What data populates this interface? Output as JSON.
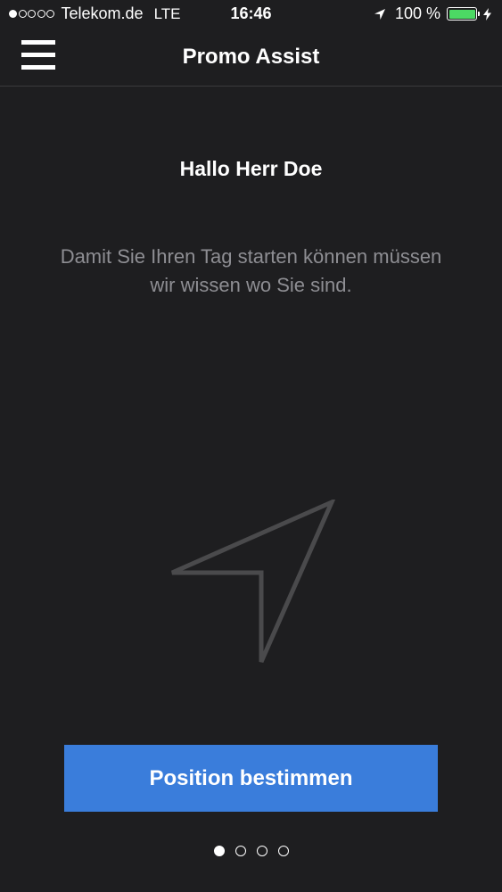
{
  "status_bar": {
    "carrier": "Telekom.de",
    "network": "LTE",
    "time": "16:46",
    "battery_percent": "100 %",
    "signal_bars_filled": 1,
    "signal_bars_total": 5,
    "battery_level": 1.0,
    "battery_color": "#4cd964",
    "icons": [
      "location-arrow-icon",
      "battery-icon",
      "charging-bolt-icon"
    ]
  },
  "nav": {
    "title": "Promo Assist",
    "menu_icon": "hamburger-menu-icon"
  },
  "content": {
    "greeting": "Hallo Herr Doe",
    "message": "Damit Sie Ihren Tag starten können müssen wir wissen wo Sie sind.",
    "illustration_icon": "navigation-arrow-icon"
  },
  "actions": {
    "primary_label": "Position bestimmen",
    "primary_color": "#3a7ddb"
  },
  "pager": {
    "total_pages": 4,
    "current_page": 1
  },
  "colors": {
    "background": "#1e1e20",
    "text_secondary": "#8e8e93"
  }
}
